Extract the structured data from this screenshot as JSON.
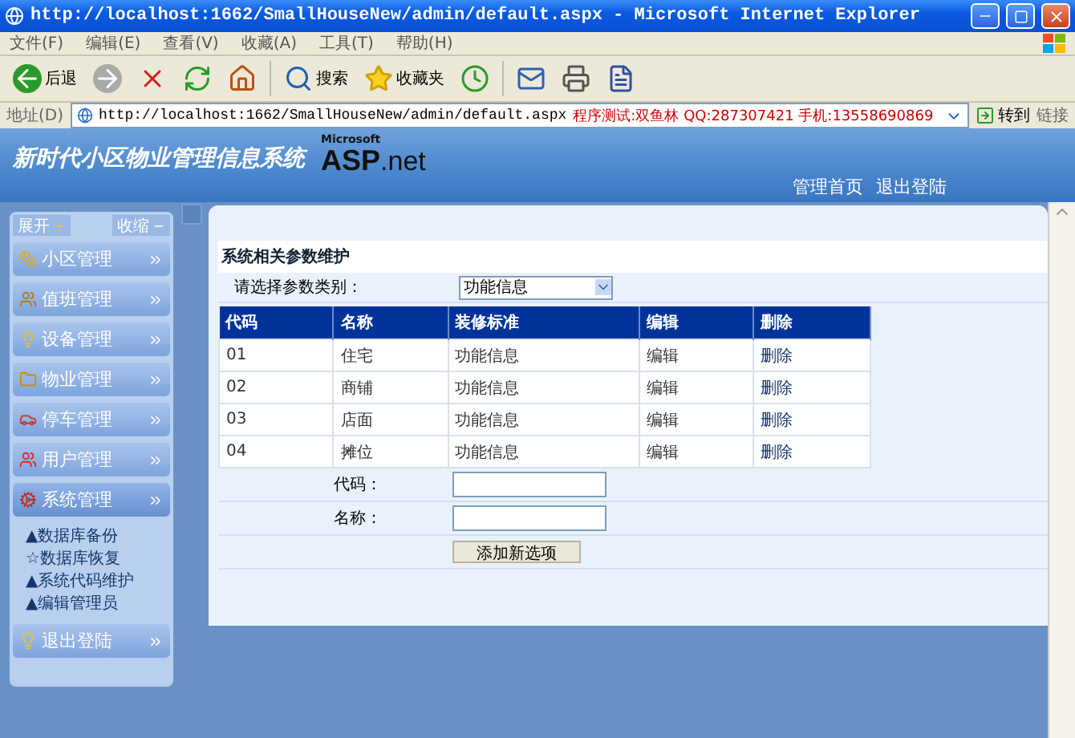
{
  "browser": {
    "title": "http://localhost:1662/SmallHouseNew/admin/default.aspx - Microsoft Internet Explorer",
    "menu": [
      "文件(F)",
      "编辑(E)",
      "查看(V)",
      "收藏(A)",
      "工具(T)",
      "帮助(H)"
    ],
    "toolbar": {
      "back": "后退",
      "search": "搜索",
      "favorites": "收藏夹"
    },
    "address": {
      "label": "地址(D)",
      "url": "http://localhost:1662/SmallHouseNew/admin/default.aspx",
      "notice": "程序测试:双鱼林 QQ:287307421 手机:13558690869",
      "go": "转到",
      "links": "链接"
    }
  },
  "app": {
    "title": "新时代小区物业管理信息系统",
    "logo_small": "Microsoft",
    "logo_main": "ASP",
    "logo_suffix": ".net",
    "links": [
      "管理首页",
      "退出登陆"
    ]
  },
  "sidebar": {
    "expand": "展开",
    "collapse": "收缩",
    "items": [
      {
        "label": "小区管理",
        "expanded": false
      },
      {
        "label": "值班管理",
        "expanded": false
      },
      {
        "label": "设备管理",
        "expanded": false
      },
      {
        "label": "物业管理",
        "expanded": false
      },
      {
        "label": "停车管理",
        "expanded": false
      },
      {
        "label": "用户管理",
        "expanded": false
      },
      {
        "label": "系统管理",
        "expanded": true,
        "children": [
          "▲数据库备份",
          "☆数据库恢复",
          "▲系统代码维护",
          "▲编辑管理员"
        ]
      },
      {
        "label": "退出登陆",
        "expanded": false
      }
    ]
  },
  "main": {
    "title": "系统相关参数维护",
    "filter": {
      "label": "请选择参数类别：",
      "value": "功能信息"
    },
    "table": {
      "columns": [
        "代码",
        "名称",
        "装修标准",
        "编辑",
        "删除"
      ],
      "rows": [
        [
          "01",
          "住宅",
          "功能信息",
          "编辑",
          "删除"
        ],
        [
          "02",
          "商铺",
          "功能信息",
          "编辑",
          "删除"
        ],
        [
          "03",
          "店面",
          "功能信息",
          "编辑",
          "删除"
        ],
        [
          "04",
          "摊位",
          "功能信息",
          "编辑",
          "删除"
        ]
      ]
    },
    "fields": [
      {
        "label": "代码："
      },
      {
        "label": "名称："
      }
    ],
    "button": "添加新选项"
  }
}
